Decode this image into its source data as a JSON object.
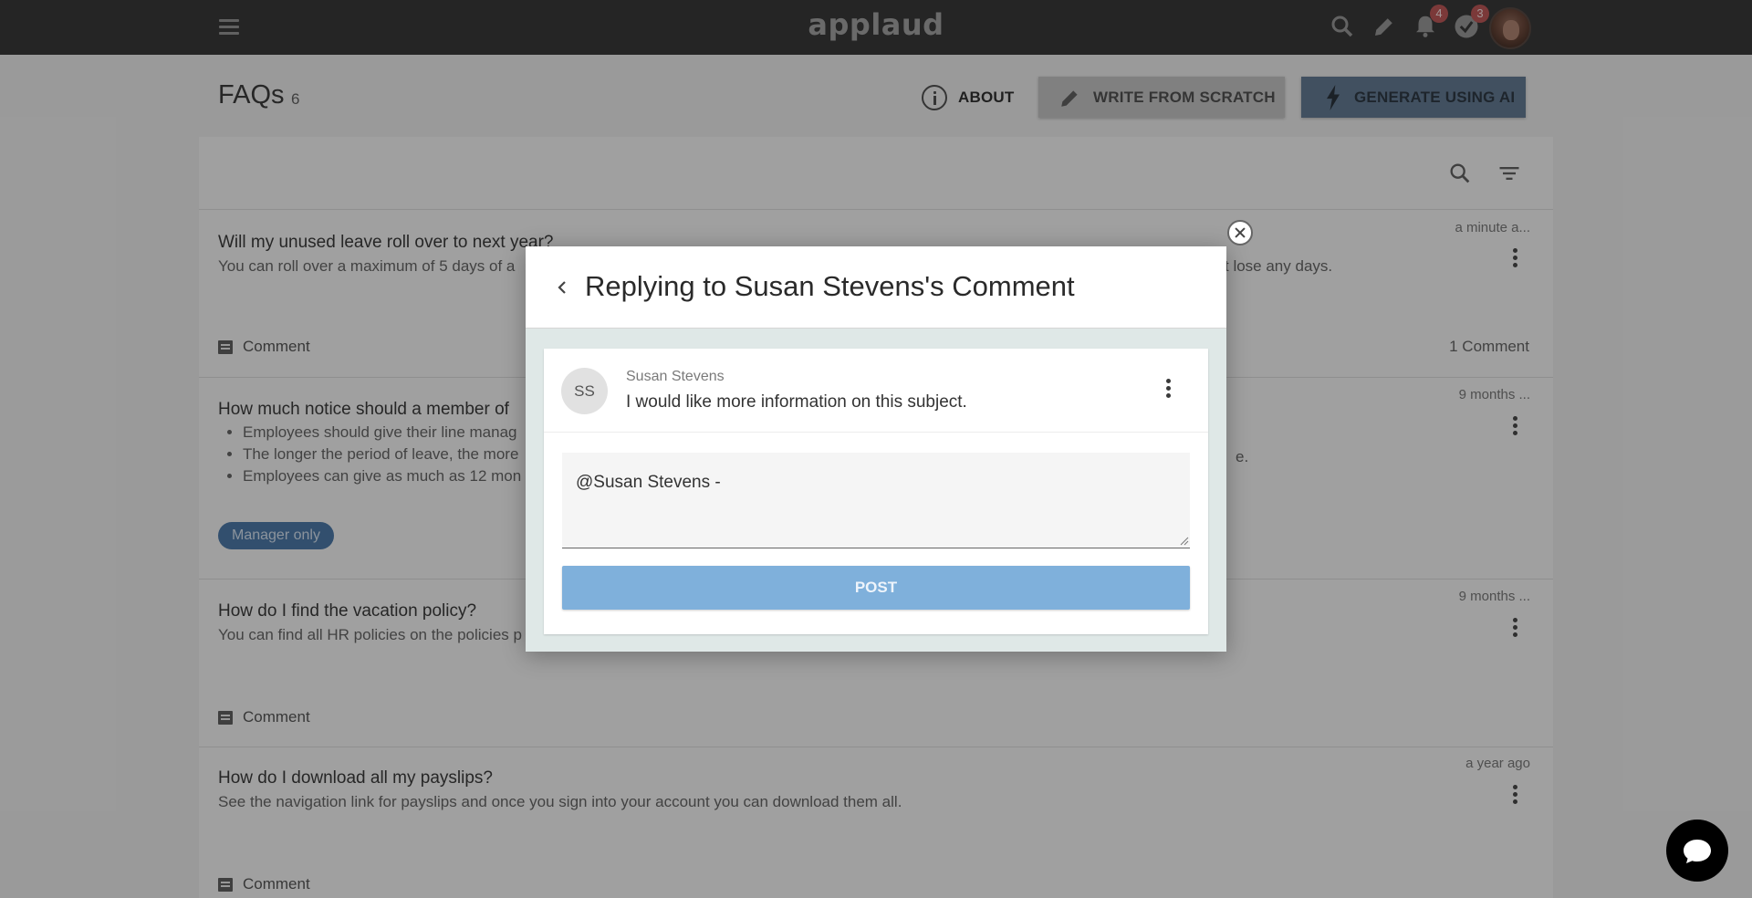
{
  "app": {
    "logo": "applaud"
  },
  "topbar": {
    "notifications_badge": "4",
    "tasks_badge": "3"
  },
  "header": {
    "title": "FAQs",
    "count": "6",
    "about_label": "ABOUT",
    "write_label": "WRITE FROM SCRATCH",
    "ai_label": "GENERATE USING AI"
  },
  "faqs": [
    {
      "question": "Will my unused leave roll over to next year?",
      "answer_left": "You can roll over a maximum of 5 days of a",
      "answer_right": "t lose any days.",
      "time": "a minute a...",
      "comment_label": "Comment",
      "comment_count": "1 Comment"
    },
    {
      "question": "How much notice should a member of",
      "bullets": [
        {
          "left": "Employees should give their line manag",
          "right": ""
        },
        {
          "left": "The longer the period of leave, the more",
          "right": "e."
        },
        {
          "left": "Employees can give as much as 12 mon",
          "right": ""
        }
      ],
      "tag": "Manager only",
      "time": "9 months ..."
    },
    {
      "question": "How do I find the vacation policy?",
      "answer_left": "You can find all HR policies on the policies p",
      "time": "9 months ...",
      "comment_label": "Comment"
    },
    {
      "question": "How do I download all my payslips?",
      "answer_left": "See the navigation link for payslips and once you sign into your account you can download them all.",
      "time": "a year ago",
      "comment_label": "Comment"
    }
  ],
  "modal": {
    "title": "Replying to Susan Stevens's Comment",
    "comment": {
      "initials": "SS",
      "author": "Susan Stevens",
      "text": "I would like more information on this subject."
    },
    "reply_value": "@Susan Stevens - ",
    "post_label": "POST"
  }
}
